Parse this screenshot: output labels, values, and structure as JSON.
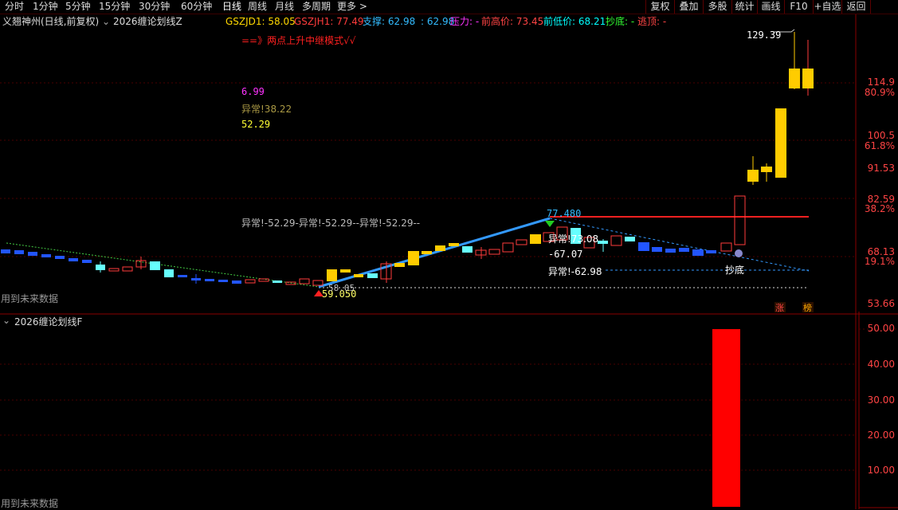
{
  "toolbar": {
    "left_items": [
      "分时",
      "1分钟",
      "5分钟",
      "15分钟",
      "30分钟",
      "60分钟",
      "日线",
      "周线",
      "月线",
      "多周期",
      "更多 >"
    ],
    "active_index": 6,
    "right_items": [
      "复权",
      "叠加",
      "多股",
      "统计",
      "画线",
      "F10",
      "+自选",
      "返回"
    ]
  },
  "infobar": {
    "title": "义翘神州(日线,前复权)",
    "indicator_name": "2026缠论划线Z",
    "gszjd1": "GSZJD1: 58.05",
    "gszjh1": "GSZJH1: 77.49",
    "support": "支撑: 62.98",
    "support_val2": ": 62.98",
    "pressure": "压力: -",
    "prev_high": "前高价: 73.45",
    "prev_low": "前低价: 68.21",
    "bottom": "抄底: -",
    "escape": "逃顶: -"
  },
  "main_chart": {
    "mode_text": "==》两点上升中继模式√√",
    "val1": "6.99",
    "val2": "异常!38.22",
    "val3": "52.29",
    "anomaly_line": "异常!-52.29-异常!-52.29--异常!-52.29--",
    "high_label": "129.39",
    "peak_label": "77.480",
    "low_label": "59.050",
    "low_label2": "58.05",
    "mid_anomaly": "异常!73.08",
    "mid_value": "-67.07",
    "mid_anomaly2": "异常!-62.98",
    "buy_label": "抄底",
    "future_note": "用到未来数据",
    "badge_zhang": "涨",
    "badge_bang": "榜",
    "axis_labels": [
      "114.9",
      "80.9%",
      "100.5",
      "61.8%",
      "91.53",
      "82.59",
      "38.2%",
      "68.13",
      "19.1%",
      "53.66"
    ]
  },
  "sub_chart": {
    "title": "2026缠论划线F",
    "future_note": "用到未来数据",
    "axis_labels": [
      "50.00",
      "40.00",
      "30.00",
      "20.00",
      "10.00"
    ]
  },
  "colors": {
    "up": "#ff3b3b",
    "down_cyan": "#66ffff",
    "down_blue": "#2255ff",
    "gold": "#ffcc00",
    "trend_blue": "#3399ff",
    "red_line": "#ff2020"
  }
}
